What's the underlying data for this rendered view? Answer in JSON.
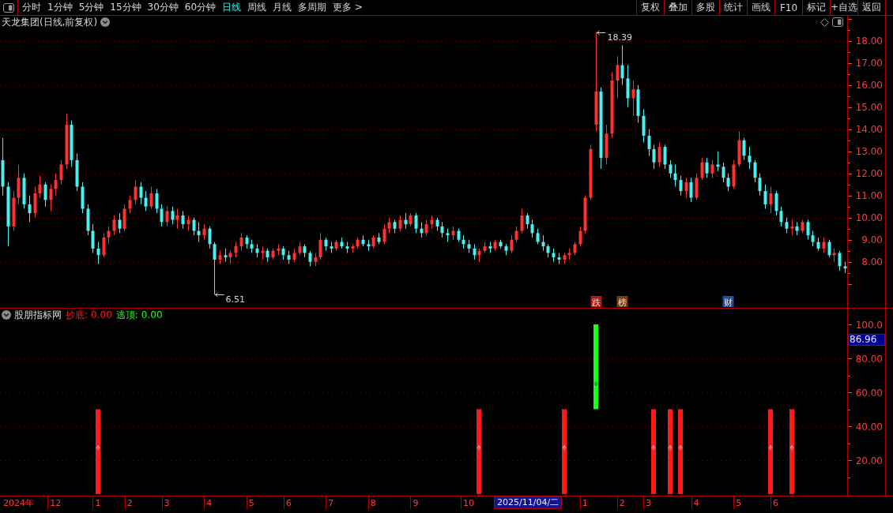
{
  "toolbar": {
    "periods": [
      {
        "label": "分时",
        "selected": false
      },
      {
        "label": "1分钟",
        "selected": false
      },
      {
        "label": "5分钟",
        "selected": false
      },
      {
        "label": "15分钟",
        "selected": false
      },
      {
        "label": "30分钟",
        "selected": false
      },
      {
        "label": "60分钟",
        "selected": false
      },
      {
        "label": "日线",
        "selected": true
      },
      {
        "label": "周线",
        "selected": false
      },
      {
        "label": "月线",
        "selected": false
      },
      {
        "label": "多周期",
        "selected": false
      },
      {
        "label": "更多 >",
        "selected": false
      }
    ],
    "actions": [
      "复权",
      "叠加",
      "多股",
      "统计",
      "画线",
      "F10",
      "标记",
      "+自选",
      "返回"
    ]
  },
  "price_pane": {
    "title": "天龙集团(日线,前复权)",
    "event_tags": [
      {
        "label": "跌",
        "color": "#b01818"
      },
      {
        "label": "榜",
        "color": "#7a3c0c"
      },
      {
        "label": "财",
        "color": "#1d4f9a"
      }
    ],
    "chart_data": [
      {
        "type": "candlestick",
        "tick_labels": "y",
        "ylim": [
          5.92,
          19.13
        ],
        "yticks": [
          {
            "value": 8,
            "label": "8.00"
          },
          {
            "value": 9,
            "label": "9.00"
          },
          {
            "value": 10,
            "label": "10.00"
          },
          {
            "value": 11,
            "label": "11.00"
          },
          {
            "value": 12,
            "label": "12.00"
          },
          {
            "value": 13,
            "label": "13.00"
          },
          {
            "value": 14,
            "label": "14.00"
          },
          {
            "value": 15,
            "label": "15.00"
          },
          {
            "value": 16,
            "label": "16.00"
          },
          {
            "value": 17,
            "label": "17.00"
          },
          {
            "value": 18,
            "label": "18.00"
          }
        ],
        "grid": true,
        "annotations": [
          "18.39",
          "6.51"
        ],
        "ohlc": [
          [
            12.6,
            13.6,
            11.0,
            11.4
          ],
          [
            11.4,
            11.6,
            8.7,
            9.6
          ],
          [
            9.6,
            11.2,
            9.4,
            10.9
          ],
          [
            10.9,
            12.4,
            10.6,
            11.8
          ],
          [
            11.8,
            12.0,
            10.4,
            10.6
          ],
          [
            10.6,
            11.0,
            9.8,
            10.2
          ],
          [
            10.2,
            11.4,
            10.0,
            11.1
          ],
          [
            11.1,
            11.9,
            10.9,
            11.5
          ],
          [
            11.5,
            11.6,
            10.5,
            10.8
          ],
          [
            10.8,
            11.5,
            10.3,
            11.3
          ],
          [
            11.3,
            12.0,
            11.0,
            11.7
          ],
          [
            11.7,
            12.6,
            11.5,
            12.4
          ],
          [
            12.4,
            14.7,
            12.2,
            14.2
          ],
          [
            14.2,
            14.4,
            12.3,
            12.6
          ],
          [
            12.6,
            12.9,
            11.2,
            11.4
          ],
          [
            11.4,
            11.6,
            10.2,
            10.4
          ],
          [
            10.4,
            10.6,
            9.2,
            9.4
          ],
          [
            9.4,
            9.7,
            8.4,
            8.6
          ],
          [
            8.6,
            8.9,
            7.9,
            8.3
          ],
          [
            8.3,
            9.3,
            8.2,
            9.1
          ],
          [
            9.1,
            9.6,
            8.8,
            9.4
          ],
          [
            9.4,
            10.1,
            9.2,
            9.9
          ],
          [
            9.9,
            10.2,
            9.3,
            9.5
          ],
          [
            9.5,
            10.6,
            9.4,
            10.4
          ],
          [
            10.4,
            11.0,
            10.2,
            10.8
          ],
          [
            10.8,
            11.7,
            10.6,
            11.4
          ],
          [
            11.4,
            11.6,
            10.6,
            10.9
          ],
          [
            10.9,
            11.2,
            10.3,
            10.5
          ],
          [
            10.5,
            11.4,
            10.4,
            11.1
          ],
          [
            11.1,
            11.3,
            10.2,
            10.4
          ],
          [
            10.4,
            10.6,
            9.6,
            9.8
          ],
          [
            9.8,
            10.5,
            9.6,
            10.3
          ],
          [
            10.3,
            10.5,
            9.7,
            9.9
          ],
          [
            9.9,
            10.4,
            9.5,
            10.1
          ],
          [
            10.1,
            10.3,
            9.5,
            9.7
          ],
          [
            9.7,
            10.1,
            9.4,
            9.9
          ],
          [
            9.9,
            10.0,
            9.2,
            9.4
          ],
          [
            9.4,
            9.8,
            8.9,
            9.2
          ],
          [
            9.2,
            9.7,
            9.0,
            9.5
          ],
          [
            9.5,
            9.6,
            8.6,
            8.8
          ],
          [
            8.8,
            8.9,
            6.51,
            8.1
          ],
          [
            8.1,
            8.5,
            7.9,
            8.3
          ],
          [
            8.3,
            8.6,
            8.0,
            8.2
          ],
          [
            8.2,
            8.5,
            7.9,
            8.4
          ],
          [
            8.4,
            8.9,
            8.2,
            8.7
          ],
          [
            8.7,
            9.3,
            8.5,
            9.1
          ],
          [
            9.1,
            9.2,
            8.6,
            8.8
          ],
          [
            8.8,
            9.0,
            8.4,
            8.6
          ],
          [
            8.6,
            8.8,
            8.2,
            8.4
          ],
          [
            8.4,
            8.7,
            8.1,
            8.5
          ],
          [
            8.5,
            8.6,
            8.0,
            8.2
          ],
          [
            8.2,
            8.6,
            8.1,
            8.5
          ],
          [
            8.5,
            8.8,
            8.3,
            8.6
          ],
          [
            8.6,
            8.7,
            8.1,
            8.3
          ],
          [
            8.3,
            8.5,
            7.9,
            8.1
          ],
          [
            8.1,
            8.6,
            8.0,
            8.4
          ],
          [
            8.4,
            8.9,
            8.3,
            8.7
          ],
          [
            8.7,
            8.8,
            8.2,
            8.4
          ],
          [
            8.4,
            8.5,
            7.8,
            8.0
          ],
          [
            8.0,
            8.4,
            7.8,
            8.2
          ],
          [
            8.2,
            9.3,
            8.1,
            9.0
          ],
          [
            9.0,
            9.1,
            8.5,
            8.7
          ],
          [
            8.7,
            8.9,
            8.4,
            8.6
          ],
          [
            8.6,
            9.0,
            8.5,
            8.9
          ],
          [
            8.9,
            9.1,
            8.6,
            8.7
          ],
          [
            8.7,
            8.9,
            8.4,
            8.6
          ],
          [
            8.6,
            8.8,
            8.4,
            8.7
          ],
          [
            8.7,
            9.1,
            8.6,
            9.0
          ],
          [
            9.0,
            9.2,
            8.7,
            8.8
          ],
          [
            8.8,
            9.0,
            8.5,
            8.7
          ],
          [
            8.7,
            9.2,
            8.6,
            9.1
          ],
          [
            9.1,
            9.3,
            8.8,
            8.9
          ],
          [
            8.9,
            9.7,
            8.8,
            9.5
          ],
          [
            9.5,
            10.0,
            9.3,
            9.8
          ],
          [
            9.8,
            9.9,
            9.3,
            9.5
          ],
          [
            9.5,
            10.1,
            9.4,
            9.9
          ],
          [
            9.9,
            10.2,
            9.5,
            9.7
          ],
          [
            9.7,
            10.2,
            9.6,
            10.1
          ],
          [
            10.1,
            10.2,
            9.3,
            9.5
          ],
          [
            9.5,
            9.8,
            9.1,
            9.3
          ],
          [
            9.3,
            9.9,
            9.2,
            9.7
          ],
          [
            9.7,
            10.1,
            9.5,
            9.9
          ],
          [
            9.9,
            10.0,
            9.4,
            9.6
          ],
          [
            9.6,
            9.8,
            9.1,
            9.3
          ],
          [
            9.3,
            9.5,
            8.9,
            9.2
          ],
          [
            9.2,
            9.6,
            9.0,
            9.4
          ],
          [
            9.4,
            9.5,
            8.9,
            9.0
          ],
          [
            9.0,
            9.2,
            8.6,
            8.8
          ],
          [
            8.8,
            9.0,
            8.4,
            8.6
          ],
          [
            8.6,
            8.8,
            8.1,
            8.3
          ],
          [
            8.3,
            8.6,
            8.0,
            8.5
          ],
          [
            8.5,
            8.9,
            8.4,
            8.7
          ],
          [
            8.7,
            8.9,
            8.4,
            8.6
          ],
          [
            8.6,
            9.0,
            8.5,
            8.9
          ],
          [
            8.9,
            9.0,
            8.6,
            8.7
          ],
          [
            8.7,
            8.8,
            8.3,
            8.5
          ],
          [
            8.5,
            9.2,
            8.4,
            9.0
          ],
          [
            9.0,
            9.6,
            8.9,
            9.4
          ],
          [
            9.4,
            10.4,
            9.3,
            10.1
          ],
          [
            10.1,
            10.2,
            9.5,
            9.7
          ],
          [
            9.7,
            9.9,
            9.1,
            9.3
          ],
          [
            9.3,
            9.5,
            8.8,
            8.9
          ],
          [
            8.9,
            9.2,
            8.5,
            8.7
          ],
          [
            8.7,
            8.8,
            8.2,
            8.4
          ],
          [
            8.4,
            8.6,
            8.0,
            8.2
          ],
          [
            8.2,
            8.4,
            7.9,
            8.1
          ],
          [
            8.1,
            8.4,
            7.9,
            8.3
          ],
          [
            8.3,
            8.6,
            8.1,
            8.4
          ],
          [
            8.4,
            8.9,
            8.3,
            8.8
          ],
          [
            8.8,
            9.6,
            8.7,
            9.4
          ],
          [
            9.4,
            11.0,
            9.3,
            10.9
          ],
          [
            10.9,
            13.3,
            10.8,
            13.1
          ],
          [
            14.2,
            18.39,
            13.9,
            15.7
          ],
          [
            15.7,
            15.9,
            12.2,
            12.7
          ],
          [
            12.7,
            14.2,
            12.4,
            13.8
          ],
          [
            13.8,
            16.6,
            13.6,
            16.2
          ],
          [
            16.2,
            17.3,
            15.4,
            16.9
          ],
          [
            16.9,
            17.8,
            16.0,
            16.3
          ],
          [
            16.3,
            16.9,
            15.0,
            15.4
          ],
          [
            15.4,
            16.2,
            14.6,
            15.8
          ],
          [
            15.8,
            16.0,
            14.3,
            14.6
          ],
          [
            14.6,
            14.9,
            13.4,
            13.7
          ],
          [
            13.7,
            14.0,
            12.8,
            13.1
          ],
          [
            13.1,
            13.3,
            12.2,
            12.5
          ],
          [
            12.5,
            13.4,
            12.3,
            13.2
          ],
          [
            13.2,
            13.3,
            12.2,
            12.4
          ],
          [
            12.4,
            12.6,
            11.8,
            12.0
          ],
          [
            12.0,
            12.4,
            11.4,
            11.7
          ],
          [
            11.7,
            11.9,
            11.0,
            11.2
          ],
          [
            11.2,
            11.8,
            10.9,
            11.6
          ],
          [
            11.6,
            11.8,
            10.7,
            10.9
          ],
          [
            10.9,
            12.0,
            10.8,
            11.8
          ],
          [
            11.8,
            12.7,
            11.7,
            12.5
          ],
          [
            12.5,
            12.7,
            11.8,
            12.0
          ],
          [
            12.0,
            12.6,
            11.8,
            12.4
          ],
          [
            12.4,
            13.0,
            12.1,
            12.3
          ],
          [
            12.3,
            12.5,
            11.6,
            11.8
          ],
          [
            11.8,
            12.0,
            11.2,
            11.4
          ],
          [
            11.4,
            12.6,
            11.3,
            12.4
          ],
          [
            12.4,
            13.9,
            12.3,
            13.5
          ],
          [
            13.5,
            13.6,
            12.6,
            12.8
          ],
          [
            12.8,
            13.2,
            12.2,
            12.5
          ],
          [
            12.5,
            12.6,
            11.6,
            11.8
          ],
          [
            11.8,
            12.0,
            11.0,
            11.2
          ],
          [
            11.2,
            11.5,
            10.4,
            10.6
          ],
          [
            10.6,
            11.4,
            10.2,
            11.1
          ],
          [
            11.1,
            11.2,
            10.1,
            10.3
          ],
          [
            10.3,
            10.5,
            9.6,
            9.8
          ],
          [
            9.8,
            10.0,
            9.3,
            9.5
          ],
          [
            9.5,
            9.9,
            9.2,
            9.6
          ],
          [
            9.6,
            9.8,
            9.2,
            9.4
          ],
          [
            9.4,
            9.9,
            9.3,
            9.8
          ],
          [
            9.8,
            9.9,
            9.0,
            9.2
          ],
          [
            9.2,
            9.4,
            8.7,
            8.9
          ],
          [
            8.9,
            9.1,
            8.5,
            8.6
          ],
          [
            8.6,
            9.1,
            8.4,
            8.9
          ],
          [
            8.9,
            9.0,
            8.2,
            8.3
          ],
          [
            8.3,
            8.6,
            8.0,
            8.4
          ],
          [
            8.4,
            8.5,
            7.6,
            7.8
          ],
          [
            7.8,
            8.0,
            7.5,
            7.7
          ]
        ]
      }
    ]
  },
  "indicator_pane": {
    "title": "股朋指标网",
    "readout_values": [
      "0.00",
      "0.00"
    ],
    "cursor": {
      "date": "2025/11/04/二",
      "value": "86.96"
    },
    "chart_data": [
      {
        "type": "bar",
        "ylim": [
          -0.9,
          109.3
        ],
        "yticks": [
          {
            "value": 20,
            "label": "20.00"
          },
          {
            "value": 40,
            "label": "40.00"
          },
          {
            "value": 60,
            "label": "60.00"
          },
          {
            "value": 80,
            "label": "80.00"
          },
          {
            "value": 100,
            "label": "100.0"
          }
        ],
        "grid": true,
        "categories": [
          null,
          null,
          null,
          "2024年",
          null,
          null,
          null,
          null,
          null,
          null,
          "12",
          null,
          null,
          null,
          null,
          null,
          null,
          null,
          "1",
          null,
          null,
          null,
          null,
          null,
          "2",
          null,
          null,
          null,
          null,
          null,
          null,
          "3",
          null,
          null,
          null,
          null,
          null,
          null,
          null,
          "4",
          null,
          null,
          null,
          null,
          null,
          null,
          null,
          "5",
          null,
          null,
          null,
          null,
          null,
          null,
          "6",
          null,
          null,
          null,
          null,
          null,
          null,
          null,
          "7",
          null,
          null,
          null,
          null,
          null,
          null,
          null,
          "8",
          null,
          null,
          null,
          null,
          null,
          null,
          null,
          "9",
          null,
          null,
          null,
          null,
          null,
          null,
          null,
          null,
          null,
          "10",
          null,
          null,
          null,
          null,
          null,
          null,
          null,
          null,
          null,
          null,
          null,
          null,
          null,
          null,
          null,
          null,
          null,
          null,
          null,
          null,
          null,
          "1",
          null,
          null,
          null,
          null,
          null,
          null,
          "2",
          null,
          null,
          null,
          null,
          "3",
          null,
          null,
          null,
          null,
          null,
          null,
          null,
          null,
          "4",
          null,
          null,
          null,
          null,
          null,
          null,
          null,
          "5",
          null,
          null,
          null,
          null,
          null,
          null,
          "6",
          null,
          null,
          null,
          null,
          null,
          null,
          null,
          null,
          null,
          null,
          null,
          null,
          null
        ],
        "series": [
          {
            "name": "抄底:",
            "color": "#ff1a1a",
            "values": [
              null,
              null,
              null,
              null,
              null,
              null,
              null,
              null,
              null,
              null,
              null,
              null,
              null,
              null,
              null,
              null,
              null,
              null,
              50,
              null,
              null,
              null,
              null,
              null,
              null,
              null,
              null,
              null,
              null,
              null,
              null,
              null,
              null,
              null,
              null,
              null,
              null,
              null,
              null,
              null,
              null,
              null,
              null,
              null,
              null,
              null,
              null,
              null,
              null,
              null,
              null,
              null,
              null,
              null,
              null,
              null,
              null,
              null,
              null,
              null,
              null,
              null,
              null,
              null,
              null,
              null,
              null,
              null,
              null,
              null,
              null,
              null,
              null,
              null,
              null,
              null,
              null,
              null,
              null,
              null,
              null,
              null,
              null,
              null,
              null,
              null,
              null,
              null,
              null,
              null,
              50,
              null,
              null,
              null,
              null,
              null,
              null,
              null,
              null,
              null,
              null,
              null,
              null,
              null,
              null,
              null,
              50,
              null,
              null,
              null,
              null,
              null,
              null,
              null,
              null,
              null,
              null,
              null,
              null,
              null,
              null,
              null,
              null,
              50,
              null,
              null,
              50,
              null,
              50,
              null,
              null,
              null,
              null,
              null,
              null,
              null,
              null,
              null,
              null,
              null,
              null,
              null,
              null,
              null,
              null,
              50,
              null,
              null,
              null,
              50,
              null,
              null,
              null,
              null,
              null,
              null,
              null,
              null,
              null,
              null
            ]
          },
          {
            "name": "逃顶:",
            "color": "#1aff1a",
            "values": [
              null,
              null,
              null,
              null,
              null,
              null,
              null,
              null,
              null,
              null,
              null,
              null,
              null,
              null,
              null,
              null,
              null,
              null,
              null,
              null,
              null,
              null,
              null,
              null,
              null,
              null,
              null,
              null,
              null,
              null,
              null,
              null,
              null,
              null,
              null,
              null,
              null,
              null,
              null,
              null,
              null,
              null,
              null,
              null,
              null,
              null,
              null,
              null,
              null,
              null,
              null,
              null,
              null,
              null,
              null,
              null,
              null,
              null,
              null,
              null,
              null,
              null,
              null,
              null,
              null,
              null,
              null,
              null,
              null,
              null,
              null,
              null,
              null,
              null,
              null,
              null,
              null,
              null,
              null,
              null,
              null,
              null,
              null,
              null,
              null,
              null,
              null,
              null,
              null,
              null,
              null,
              null,
              null,
              null,
              null,
              null,
              null,
              null,
              null,
              null,
              null,
              null,
              null,
              null,
              null,
              null,
              null,
              null,
              null,
              null,
              null,
              null,
              50,
              null,
              null,
              null,
              null,
              null,
              null,
              null,
              null,
              null,
              null,
              null,
              null,
              null,
              null,
              null,
              null,
              null,
              null,
              null,
              null,
              null,
              null,
              null,
              null,
              null,
              null,
              null,
              null,
              null,
              null,
              null,
              null,
              null,
              null,
              null,
              null,
              null,
              null,
              null,
              null,
              null,
              null,
              null,
              null,
              null,
              null,
              null
            ],
            "base": [
              null,
              null,
              null,
              null,
              null,
              null,
              null,
              null,
              null,
              null,
              null,
              null,
              null,
              null,
              null,
              null,
              null,
              null,
              null,
              null,
              null,
              null,
              null,
              null,
              null,
              null,
              null,
              null,
              null,
              null,
              null,
              null,
              null,
              null,
              null,
              null,
              null,
              null,
              null,
              null,
              null,
              null,
              null,
              null,
              null,
              null,
              null,
              null,
              null,
              null,
              null,
              null,
              null,
              null,
              null,
              null,
              null,
              null,
              null,
              null,
              null,
              null,
              null,
              null,
              null,
              null,
              null,
              null,
              null,
              null,
              null,
              null,
              null,
              null,
              null,
              null,
              null,
              null,
              null,
              null,
              null,
              null,
              null,
              null,
              null,
              null,
              null,
              null,
              null,
              null,
              null,
              null,
              null,
              null,
              null,
              null,
              null,
              null,
              null,
              null,
              null,
              null,
              null,
              null,
              null,
              null,
              null,
              null,
              null,
              null,
              null,
              null,
              50,
              null,
              null,
              null,
              null,
              null,
              null,
              null,
              null,
              null,
              null,
              null,
              null,
              null,
              null,
              null,
              null,
              null,
              null,
              null,
              null,
              null,
              null,
              null,
              null,
              null,
              null,
              null,
              null,
              null,
              null,
              null,
              null,
              null,
              null,
              null,
              null,
              null,
              null,
              null,
              null,
              null,
              null,
              null,
              null,
              null,
              null,
              null
            ]
          }
        ]
      }
    ]
  }
}
